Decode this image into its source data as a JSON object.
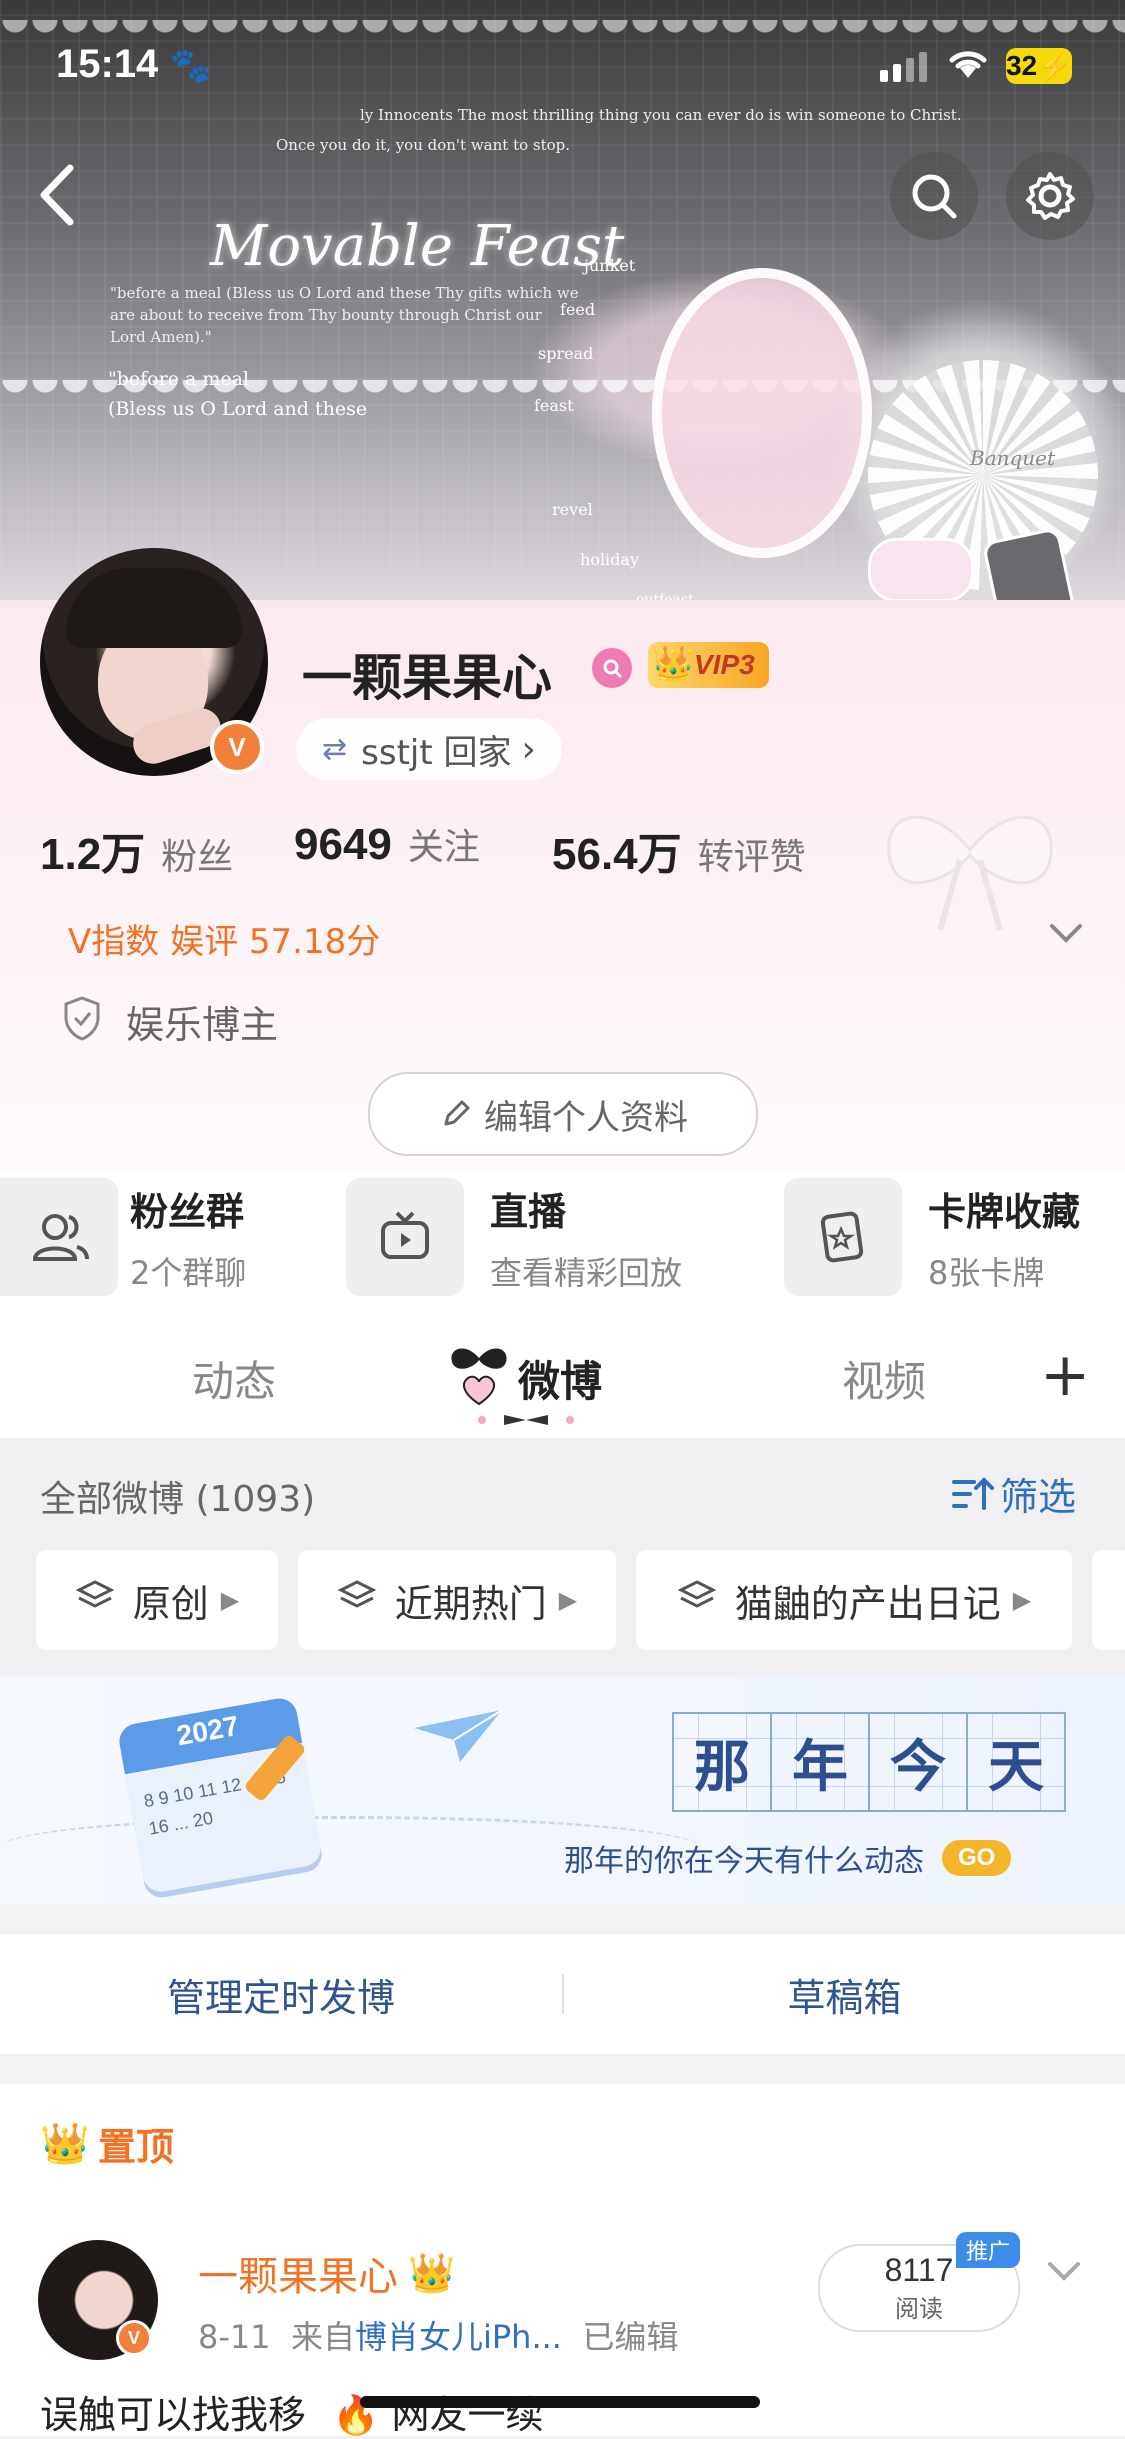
{
  "status_bar": {
    "time": "15:14",
    "battery": "32"
  },
  "banner": {
    "title": "Movable Feast",
    "lines": [
      "ly Innocents The most thrilling thing you can ever do is win someone to Christ.",
      "Once you do it, you don't want to stop."
    ],
    "side_words": [
      "junket",
      "feed",
      "spread",
      "feast",
      "revel",
      "holiday",
      "outfeast"
    ],
    "quote": "\"before a meal (Bless us O Lord and these Thy gifts which we are about to receive from Thy bounty through Christ our Lord Amen).\"",
    "quote2": "\"before a meal",
    "quote3": "(Bless us O Lord and these",
    "card": "Banquet"
  },
  "profile": {
    "name": "一颗果果心",
    "vip": "VIP3",
    "home_link": "sstjt 回家",
    "home_chevron": "›",
    "stats": [
      {
        "value": "1.2万",
        "label": "粉丝"
      },
      {
        "value": "9649",
        "label": "关注"
      },
      {
        "value": "56.4万",
        "label": "转评赞"
      }
    ],
    "v_index": "V指数 娱评 57.18分",
    "category": "娱乐博主",
    "edit_label": "编辑个人资料"
  },
  "features": [
    {
      "title": "粉丝群",
      "sub": "2个群聊",
      "icon": "fans-group-icon"
    },
    {
      "title": "直播",
      "sub": "查看精彩回放",
      "icon": "tv-icon"
    },
    {
      "title": "卡牌收藏",
      "sub": "8张卡牌",
      "icon": "card-icon"
    }
  ],
  "tabs": {
    "items": [
      "动态",
      "微博",
      "视频"
    ],
    "active": "微博",
    "add": "+"
  },
  "filters": {
    "summary": "全部微博 (1093)",
    "filter_label": "筛选",
    "chips": [
      "原创",
      "近期热门",
      "猫鼬的产出日记"
    ]
  },
  "promo": {
    "calendar_year": "2027",
    "calendar_days": "8 9 10 11 12 ... 15 16 ... 20",
    "chars": [
      "那",
      "年",
      "今",
      "天"
    ],
    "subtitle": "那年的你在今天有什么动态",
    "go": "GO"
  },
  "actions": {
    "scheduled": "管理定时发博",
    "drafts": "草稿箱"
  },
  "pinned": {
    "header": "置顶",
    "author": "一颗果果心",
    "meta_date": "8-11",
    "meta_from": "来自",
    "meta_source": "博肖女儿iPh...",
    "meta_edited": "已编辑",
    "reads": "8117",
    "reads_label": "阅读",
    "promo_tag": "推广",
    "text_start": "误触可以找我移",
    "text_end": "网友一续"
  },
  "colors": {
    "accent_orange": "#f07325",
    "weibo_orange": "#f2803a",
    "link_blue": "#2f6fc2"
  }
}
